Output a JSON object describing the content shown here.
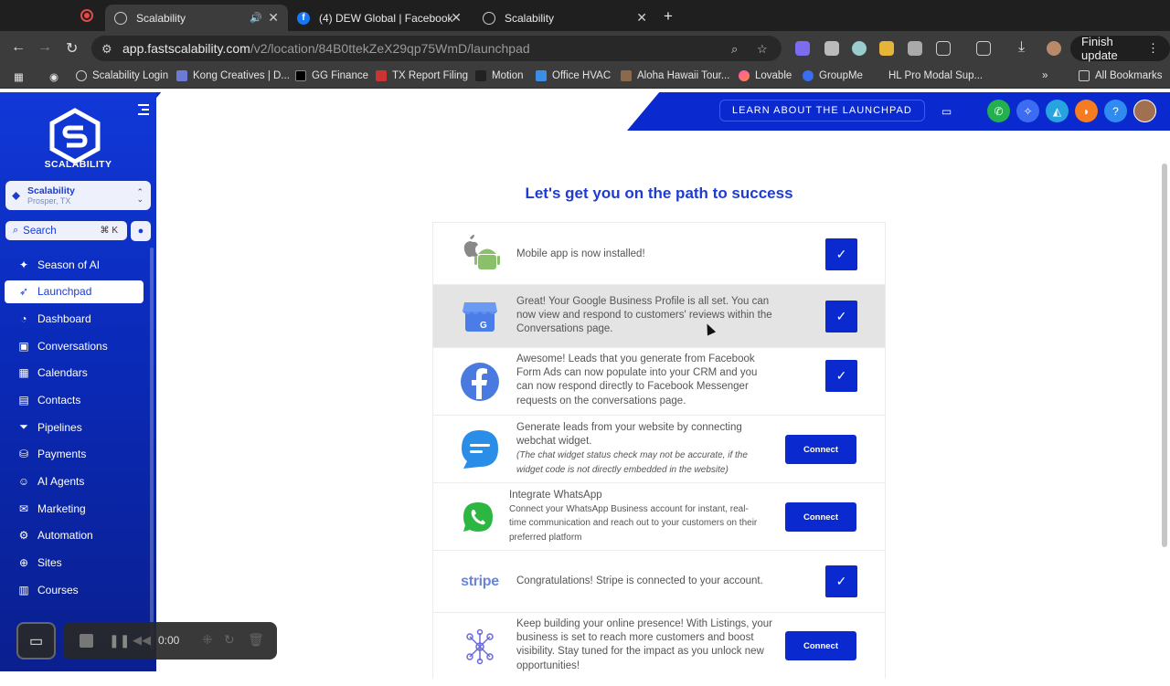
{
  "browser": {
    "tabs": [
      {
        "title": "Scalability",
        "active": true
      },
      {
        "title": "(4) DEW Global | Facebook",
        "active": false
      },
      {
        "title": "Scalability",
        "active": false
      }
    ],
    "url_host": "app.fastscalability.com",
    "url_path": "/v2/location/84B0ttekZeX29qp75WmD/launchpad",
    "finish_update": "Finish update",
    "bookmarks": [
      "Scalability Login",
      "Kong Creatives | D...",
      "GG Finance",
      "TX Report Filing",
      "Motion",
      "Office HVAC",
      "Aloha Hawaii Tour...",
      "Lovable",
      "GroupMe",
      "HL Pro Modal Sup...",
      "All Bookmarks"
    ]
  },
  "sidebar": {
    "brand": "SCALABILITY",
    "location_name": "Scalability",
    "location_city": "Prosper, TX",
    "search_placeholder": "Search",
    "search_shortcut": "⌘ K",
    "items": [
      {
        "label": "Season of AI",
        "icon": "sparkle-icon"
      },
      {
        "label": "Launchpad",
        "icon": "rocket-icon",
        "active": true
      },
      {
        "label": "Dashboard",
        "icon": "gauge-icon"
      },
      {
        "label": "Conversations",
        "icon": "chat-icon"
      },
      {
        "label": "Calendars",
        "icon": "calendar-icon"
      },
      {
        "label": "Contacts",
        "icon": "contact-card-icon"
      },
      {
        "label": "Pipelines",
        "icon": "funnel-icon"
      },
      {
        "label": "Payments",
        "icon": "payments-icon"
      },
      {
        "label": "AI Agents",
        "icon": "agent-icon"
      },
      {
        "label": "Marketing",
        "icon": "send-icon"
      },
      {
        "label": "Automation",
        "icon": "workflow-icon"
      },
      {
        "label": "Sites",
        "icon": "globe-icon"
      },
      {
        "label": "Courses",
        "icon": "courses-icon"
      }
    ]
  },
  "topbar": {
    "learn_label": "LEARN ABOUT THE LAUNCHPAD"
  },
  "main": {
    "heading": "Let's get you on the path to success",
    "rows": [
      {
        "text": "Mobile app is now installed!",
        "status": "done"
      },
      {
        "text": "Great! Your Google Business Profile is all set. You can now view and respond to customers' reviews within the Conversations page.",
        "status": "done"
      },
      {
        "text": "Awesome! Leads that you generate from Facebook Form Ads can now populate into your CRM and you can now respond directly to Facebook Messenger requests on the conversations page.",
        "status": "done"
      },
      {
        "text": "Generate leads from your website by connecting webchat widget.",
        "note": "(The chat widget status check may not be accurate, if the widget code is not directly embedded in the website)",
        "status": "connect",
        "button": "Connect"
      },
      {
        "title": "Integrate WhatsApp",
        "text": "Connect your WhatsApp Business account for instant, real-time communication and reach out to your customers on their preferred platform",
        "status": "connect",
        "button": "Connect"
      },
      {
        "text": "Congratulations! Stripe is connected to your account.",
        "status": "done",
        "logo": "stripe"
      },
      {
        "text": "Keep building your online presence! With Listings, your business is set to reach more customers and boost visibility. Stay tuned for the impact as you unlock new opportunities!",
        "status": "connect",
        "button": "Connect"
      }
    ]
  },
  "recorder": {
    "time": "0:00"
  }
}
